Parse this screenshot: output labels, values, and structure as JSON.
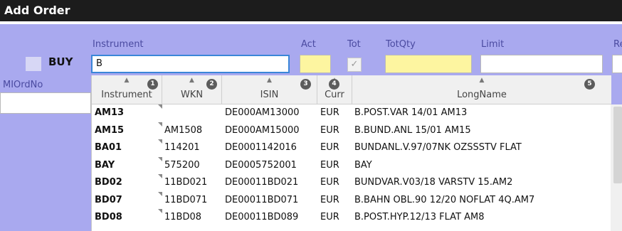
{
  "window": {
    "title": "Add Order"
  },
  "side": {
    "buy_label": "BUY",
    "mi_ord_no_label": "MIOrdNo",
    "mi_ord_no_value": ""
  },
  "fields": {
    "instrument_label": "Instrument",
    "instrument_value": "B",
    "act_label": "Act",
    "tot_label": "Tot",
    "totqty_label": "TotQty",
    "limit_label": "Limit",
    "next_label": "Re",
    "act_value": "",
    "totqty_value": "",
    "limit_value": ""
  },
  "colors": {
    "accent": "#3a86d8",
    "panel": "#a9a9ef",
    "yellow": "#fdf5a0",
    "titlebar": "#1c1c1c"
  },
  "dropdown": {
    "columns": [
      {
        "label": "Instrument",
        "badge": "1"
      },
      {
        "label": "WKN",
        "badge": "2"
      },
      {
        "label": "ISIN",
        "badge": "3"
      },
      {
        "label": "Curr",
        "badge": "4"
      },
      {
        "label": "LongName",
        "badge": "5"
      }
    ],
    "rows": [
      {
        "instrument": "AM13",
        "wkn": "",
        "isin": "DE000AM13000",
        "curr": "EUR",
        "longname": "B.POST.VAR 14/01 AM13"
      },
      {
        "instrument": "AM15",
        "wkn": "AM1508",
        "isin": "DE000AM15000",
        "curr": "EUR",
        "longname": "B.BUND.ANL 15/01 AM15"
      },
      {
        "instrument": "BA01",
        "wkn": "114201",
        "isin": "DE0001142016",
        "curr": "EUR",
        "longname": "BUNDANL.V.97/07NK OZSSSTV FLAT"
      },
      {
        "instrument": "BAY",
        "wkn": "575200",
        "isin": "DE0005752001",
        "curr": "EUR",
        "longname": "BAY"
      },
      {
        "instrument": "BD02",
        "wkn": "11BD021",
        "isin": "DE00011BD021",
        "curr": "EUR",
        "longname": "BUNDVAR.V03/18 VARSTV 15.AM2"
      },
      {
        "instrument": "BD07",
        "wkn": "11BD071",
        "isin": "DE00011BD071",
        "curr": "EUR",
        "longname": "B.BAHN OBL.90 12/20 NOFLAT 4Q.AM7"
      },
      {
        "instrument": "BD08",
        "wkn": "11BD08",
        "isin": "DE00011BD089",
        "curr": "EUR",
        "longname": "B.POST.HYP.12/13 FLAT AM8"
      }
    ]
  }
}
